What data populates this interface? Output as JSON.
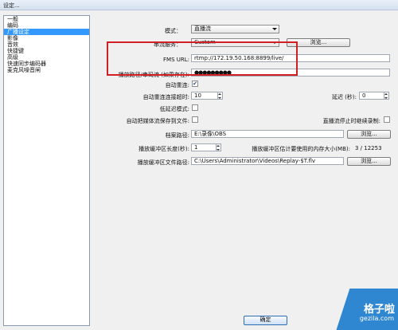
{
  "window": {
    "title": "设定..."
  },
  "sidebar": {
    "items": [
      {
        "label": "一般"
      },
      {
        "label": "编码"
      },
      {
        "label": "广播设定"
      },
      {
        "label": "影像"
      },
      {
        "label": "音效"
      },
      {
        "label": "快捷键"
      },
      {
        "label": "高级"
      },
      {
        "label": "快速同步编码器"
      },
      {
        "label": "麦克风噪音闸"
      }
    ],
    "selected_index": 2
  },
  "settings": {
    "mode": {
      "label": "模式：",
      "value": "直播流"
    },
    "service": {
      "label": "串流服务：",
      "value": "Custom",
      "browse": "浏览..."
    },
    "fms_url": {
      "label": "FMS URL:",
      "value": "rtmp://172.19.50.168:8899/live/"
    },
    "stream_key": {
      "label": "播放路径/串码流 (如果存在):",
      "value": "●●●●●●●●●"
    },
    "auto_reconnect": {
      "label": "自动重连:",
      "checked": true,
      "check_glyph": "✔"
    },
    "reconnect_timeout": {
      "label": "自动重连连接超时:",
      "value": "10"
    },
    "delay": {
      "label": "延迟 (秒):",
      "value": "0"
    },
    "low_latency": {
      "label": "低延迟模式:",
      "checked": false
    },
    "auto_save": {
      "label": "自动把媒体流保存到文件:",
      "checked": false
    },
    "keep_recording": {
      "label": "直播流停止时继续录制:",
      "checked": false
    },
    "file_path": {
      "label": "档案路径:",
      "value": "E:\\录像\\OBS",
      "browse": "浏览..."
    },
    "replay_length": {
      "label": "播放缓冲区长度(秒):",
      "value": "1"
    },
    "replay_memory": {
      "label": "播放缓冲区估计要使用的内存大小(MB):",
      "value": "3 / 12253"
    },
    "replay_path": {
      "label": "播放缓冲区文件路径:",
      "value": "C:\\Users\\Administrator\\Videos\\Replay-$T.flv",
      "browse": "浏览..."
    }
  },
  "footer": {
    "ok_label": "确定"
  },
  "watermark": {
    "title": "格子啦",
    "site": "gezila.com"
  },
  "colors": {
    "highlight_box": "#d21f26",
    "selection": "#3399ff",
    "watermark": "#2f86d1"
  }
}
